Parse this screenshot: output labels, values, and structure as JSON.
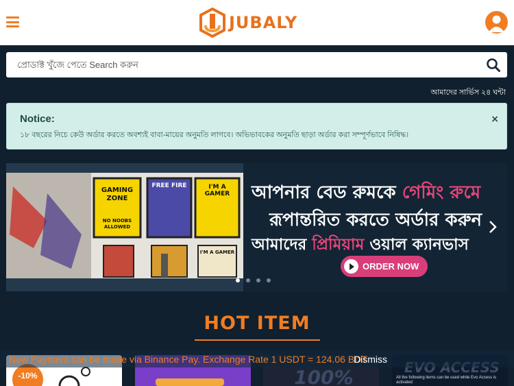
{
  "header": {
    "logo_text": "JUBALY"
  },
  "search": {
    "placeholder": "প্রোডাক্ট খুঁজে পেতে Search করুন"
  },
  "service_text": "আমাদের সার্ভিস ২৪ ঘন্টা",
  "notice": {
    "title": "Notice:",
    "body": "১৮ বছরের নিচে কেউ অর্ডার করতে অবশ্যই বাবা-মায়ের অনুমতি লাগবে। অভিভাবকের অনুমতি ছাড়া অর্ডার করা সম্পূর্ণভাবে নিষিদ্ধ।",
    "close": "×"
  },
  "banner": {
    "line1_white": "আপনার বেড রুমকে",
    "line1_pink": "গেমিং রুমে",
    "line2": "রূপান্তরিত করতে অর্ডার করুন",
    "line3_white_a": "আমাদের",
    "line3_pink": "প্রিমিয়াম",
    "line3_white_b": "ওয়াল ক্যানভাস",
    "order_button": "ORDER NOW",
    "posters": [
      "GAMING ZONE",
      "NO NOOBS ALLOWED",
      "FREE FIRE",
      "I'M A GAMER",
      "I'M A GAMER"
    ]
  },
  "slider": {
    "dot_count": 4,
    "active_index": 0
  },
  "hot_item_title": "HOT ITEM",
  "cards": [
    {
      "badge": "-10%"
    },
    {
      "badge": ""
    },
    {
      "badge": "",
      "label": "100%"
    },
    {
      "badge": "",
      "label": "EVO ACCESS",
      "caption": "All the following items can be used while Evo Access is activated"
    }
  ],
  "payment_bar": {
    "text": "Now Payment can be made via Binance Pay. Exchange Rate 1 USDT = 124.06 BDT",
    "dismiss": "Dismiss"
  },
  "colors": {
    "accent": "#f07d22",
    "page_bg": "#10202e",
    "notice_bg": "#d3eee8",
    "order_btn": "#d83e7a"
  },
  "icons": [
    "menu-icon",
    "user-icon",
    "search-icon",
    "close-icon",
    "play-icon",
    "chevron-right-icon"
  ]
}
